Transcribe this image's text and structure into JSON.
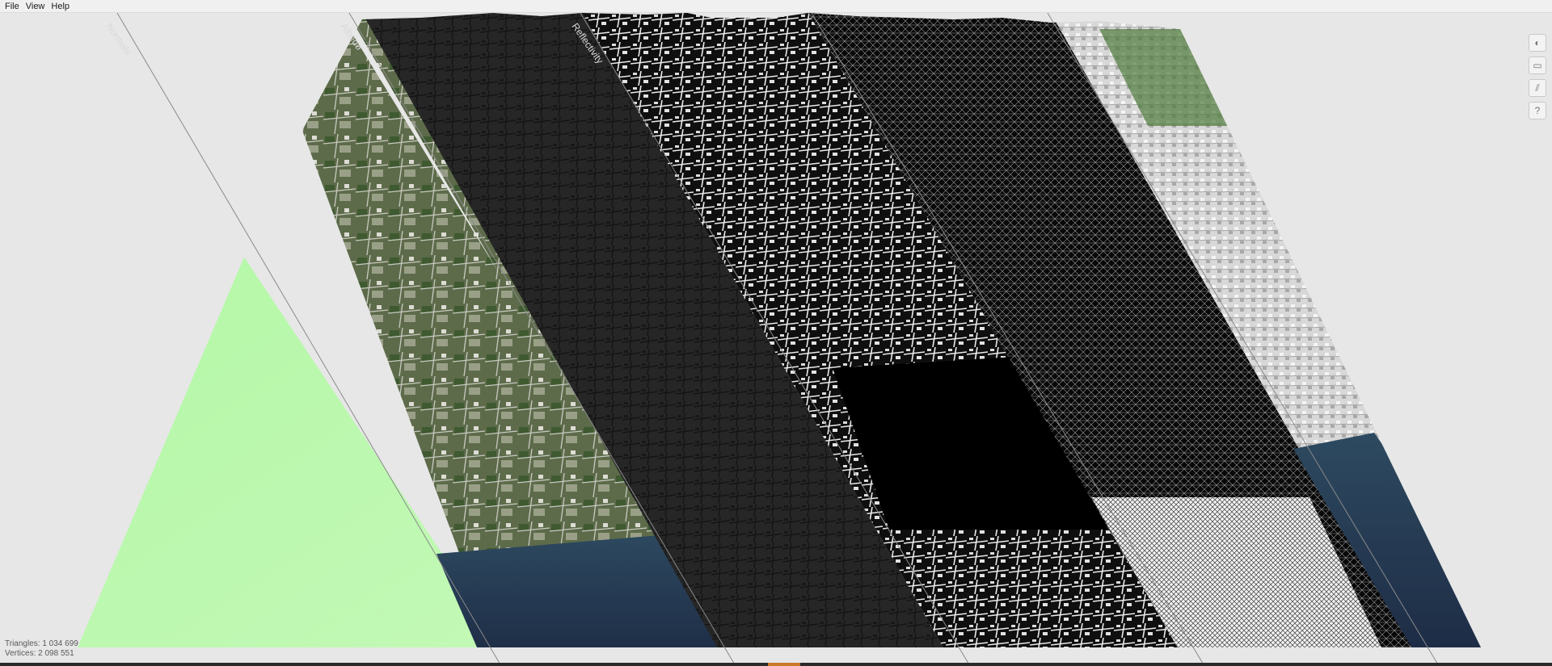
{
  "menu": {
    "items": [
      "File",
      "View",
      "Help"
    ]
  },
  "viewport": {
    "lanes": [
      {
        "label": "Normals",
        "color": "#b9f4a8"
      },
      {
        "label": "Albedo",
        "color": "#5f7d4d"
      },
      {
        "label": "Reflectivity",
        "color": "#2a2a2a"
      },
      {
        "label": "",
        "color": "#111111"
      },
      {
        "label": "",
        "color": "#0d0d0d"
      },
      {
        "label": "",
        "color": "#dcdcdc"
      }
    ]
  },
  "toolbar": {
    "buttons": [
      {
        "icon": "compass-icon",
        "glyph": "◐"
      },
      {
        "icon": "window-icon",
        "glyph": "▭"
      },
      {
        "icon": "layers-icon",
        "glyph": "⫽"
      },
      {
        "icon": "help-icon",
        "glyph": "?"
      }
    ]
  },
  "stats": {
    "triangles_label": "Triangles:",
    "triangles_value": "1 034 699",
    "vertices_label": "Vertices:",
    "vertices_value": "2 098 551"
  }
}
